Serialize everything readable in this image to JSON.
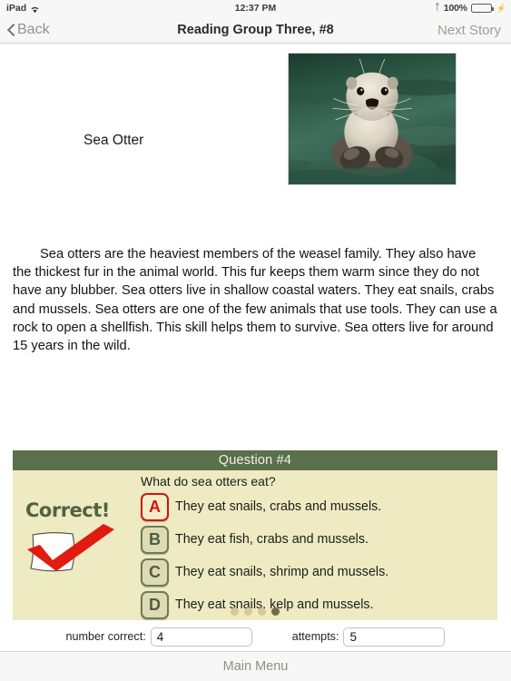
{
  "status_bar": {
    "device": "iPad",
    "wifi_icon": "wifi-icon",
    "time": "12:37 PM",
    "bluetooth_icon": "bluetooth-icon",
    "battery_percent": "100%",
    "battery_icon": "battery-full-icon",
    "charging_icon": "charging-bolt-icon"
  },
  "nav_bar": {
    "back_label": "Back",
    "back_icon": "chevron-left-icon",
    "title": "Reading Group Three, #8",
    "next_label": "Next Story"
  },
  "story": {
    "title": "Sea Otter",
    "image_alt": "sea-otter-photo",
    "body": "Sea otters are the heaviest members of the weasel family. They also have the thickest fur in the animal world. This fur keeps them warm since they do not have any blubber. Sea otters live in shallow coastal waters. They eat snails, crabs and mussels. Sea otters are one of the few animals that use tools. They can use a rock to open a shellfish. This skill helps them to survive. Sea otters live for around 15 years in the wild."
  },
  "quiz": {
    "header": "Question #4",
    "question": "What do sea otters eat?",
    "feedback_text": "Correct!",
    "feedback_icon": "red-checkmark-icon",
    "choices": [
      {
        "letter": "A",
        "text": "They eat snails, crabs and mussels.",
        "state": "selected"
      },
      {
        "letter": "B",
        "text": "They eat fish, crabs and mussels.",
        "state": "normal"
      },
      {
        "letter": "C",
        "text": "They eat snails, shrimp and mussels.",
        "state": "normal"
      },
      {
        "letter": "D",
        "text": "They eat snails, kelp and mussels.",
        "state": "normal"
      }
    ],
    "dots": [
      {
        "active": false
      },
      {
        "active": false
      },
      {
        "active": false
      },
      {
        "active": true
      }
    ]
  },
  "score": {
    "correct_label": "number correct:",
    "correct_value": "4",
    "attempts_label": "attempts:",
    "attempts_value": "5"
  },
  "toolbar": {
    "main_menu_label": "Main Menu"
  },
  "colors": {
    "quiz_header_green": "#59704b",
    "quiz_body_cream": "#eeeac1",
    "selected_red": "#d81212",
    "badge_green": "#6d7a5c",
    "battery_green": "#35c840"
  }
}
